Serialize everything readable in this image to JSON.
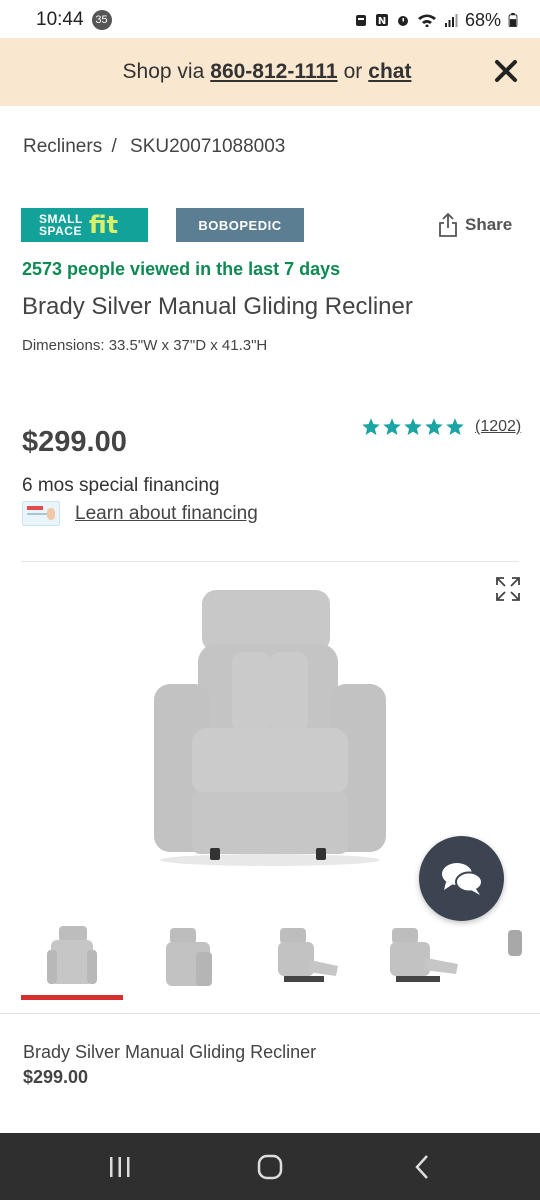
{
  "status_bar": {
    "time": "10:44",
    "notification_count": "35",
    "battery": "68%"
  },
  "promo": {
    "prefix": "Shop via",
    "phone": "860-812-1111",
    "middle": "or",
    "chat": "chat"
  },
  "breadcrumb": {
    "category": "Recliners",
    "separator": "/",
    "sku": "SKU20071088003"
  },
  "badges": {
    "ssf_line1": "SMALL",
    "ssf_line2": "SPACE",
    "ssf_fit": "fit",
    "brand": "BOBOPEDIC"
  },
  "share_label": "Share",
  "product": {
    "viewed": "2573 people viewed in the last 7 days",
    "title": "Brady Silver Manual Gliding Recliner",
    "dimensions": "Dimensions: 33.5\"W x 37\"D x 41.3\"H",
    "price": "$299.00",
    "rating": 5,
    "rating_count": "(1202)",
    "financing": "6 mos special financing",
    "financing_link": "Learn about financing"
  },
  "footer": {
    "name": "Brady Silver Manual Gliding Recliner",
    "price": "$299.00"
  },
  "colors": {
    "accent_teal": "#13a29a",
    "viewed_green": "#0e8a53",
    "star": "#1ba4a4",
    "promo_bg": "#f9e7cf",
    "selected_red": "#d32f2f"
  },
  "icons": [
    "share-icon",
    "close-icon",
    "expand-icon",
    "chat-icon",
    "star-icon",
    "recents-icon",
    "home-icon",
    "back-icon"
  ]
}
